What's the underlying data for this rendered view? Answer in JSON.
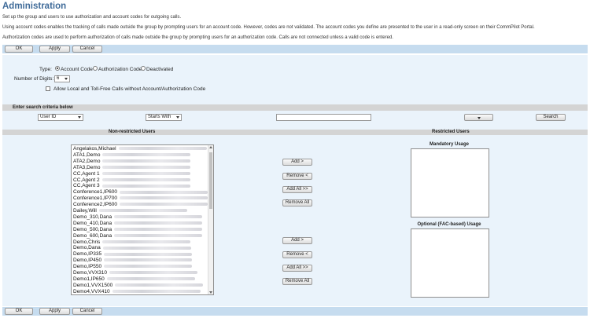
{
  "page": {
    "title": "Administration",
    "intro_lines": [
      "Set up the group and users to use authorization and account codes for outgoing calls.",
      "Using account codes enables the tracking of calls made outside the group by prompting users for an account code. However, codes are not validated. The account codes you define are presented to the user in a read-only screen on their CommPilot Portal.",
      "Authorization codes are used to perform authorization of calls made outside the group by prompting users for an authorization code. Calls are not connected unless a valid code is entered."
    ]
  },
  "buttons": {
    "ok": "OK",
    "apply": "Apply",
    "cancel": "Cancel"
  },
  "settings": {
    "type_label": "Type:",
    "type_options": [
      "Account Code",
      "Authorization Code",
      "Deactivated"
    ],
    "type_selected": "Account Code",
    "digits_label": "Number of Digits:",
    "digits_value": "6",
    "allow_local_label": "Allow Local and Toll-Free Calls without Account/Authorization Code",
    "allow_local_checked": false
  },
  "search": {
    "header": "Enter search criteria below",
    "field": "User ID",
    "mode": "Starts With",
    "value": "",
    "extra_select": "",
    "button": "Search"
  },
  "lists": {
    "nonrestricted_header": "Non-restricted Users",
    "restricted_header": "Restricted Users",
    "nonrestricted_users": [
      "Angelakos,Michael",
      "ATA1,Demo",
      "ATA2,Demo",
      "ATA3,Demo",
      "CC,Agent 1",
      "CC,Agent 2",
      "CC,Agent 3",
      "Conference1,IP600",
      "Conference1,IP700",
      "Conference2,IP600",
      "Dailey,Will",
      "Demo_310,Dana",
      "Demo_410,Dana",
      "Demo_500,Dana",
      "Demo_600,Dana",
      "Demo,Chris",
      "Demo,Dana",
      "Demo,IP335",
      "Demo,IP450",
      "Demo,IP550",
      "Demo,VVX310",
      "Demo1,IP650",
      "Demo1,VVX1500",
      "Demo4,VVX410"
    ],
    "mandatory_label": "Mandatory Usage",
    "optional_label": "Optional (FAC-based) Usage",
    "move_buttons": {
      "add": "Add >",
      "remove": "Remove <",
      "add_all": "Add All >>",
      "remove_all": "Remove All"
    }
  },
  "icons": {
    "caret": "chevron-down-icon",
    "radio": "radio-icon",
    "checkbox": "checkbox-icon"
  },
  "colors": {
    "title": "#3f6b99",
    "button_bar": "#c6dcef",
    "panel": "#eaf3fb",
    "section_header": "#d4d4d4"
  }
}
